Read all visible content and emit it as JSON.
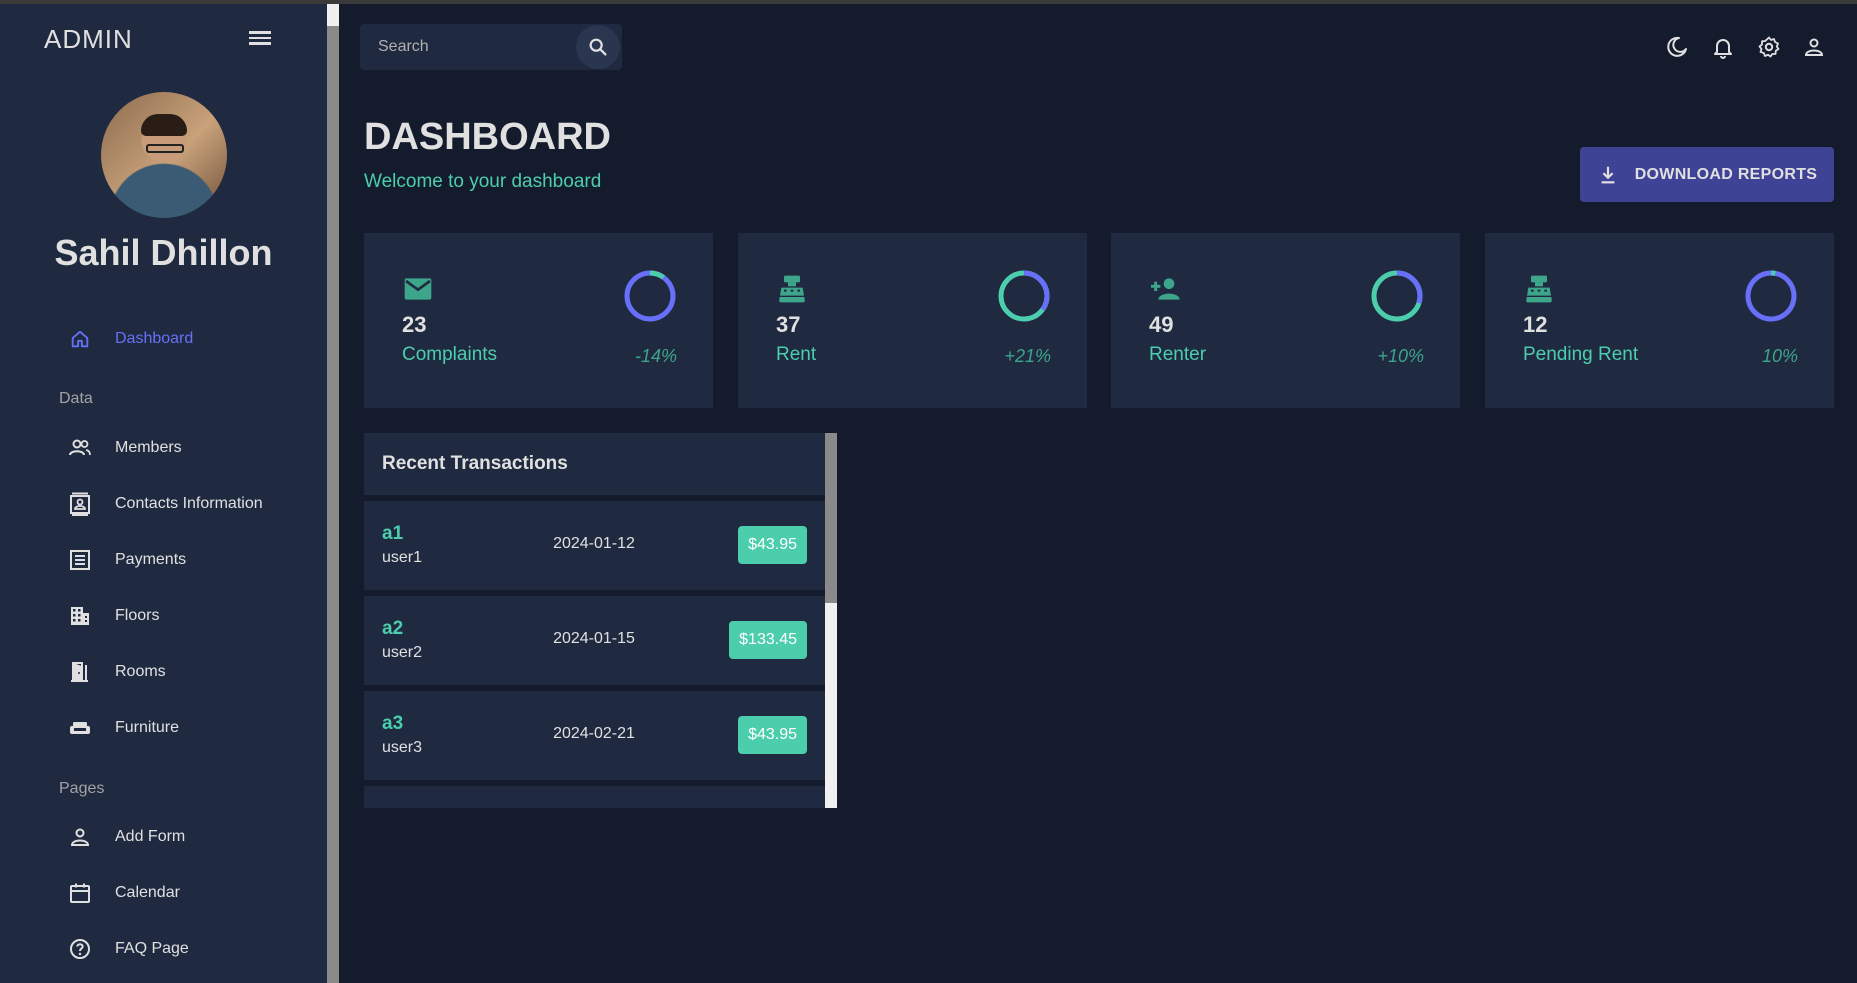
{
  "sidebar": {
    "brand": "ADMIN",
    "user_name": "Sahil Dhillon",
    "nav": [
      {
        "label": "Dashboard",
        "icon": "home-icon",
        "active": true
      },
      {
        "label": "Members",
        "icon": "people-icon"
      },
      {
        "label": "Contacts Information",
        "icon": "contacts-icon"
      },
      {
        "label": "Payments",
        "icon": "receipt-icon"
      },
      {
        "label": "Floors",
        "icon": "building-icon"
      },
      {
        "label": "Rooms",
        "icon": "door-icon"
      },
      {
        "label": "Furniture",
        "icon": "sofa-icon"
      },
      {
        "label": "Add Form",
        "icon": "person-icon"
      },
      {
        "label": "Calendar",
        "icon": "calendar-icon"
      },
      {
        "label": "FAQ Page",
        "icon": "help-icon"
      }
    ],
    "sections": {
      "data": "Data",
      "pages": "Pages"
    }
  },
  "topbar": {
    "search_placeholder": "Search",
    "icons": [
      "moon-icon",
      "bell-icon",
      "gear-icon",
      "person-icon"
    ]
  },
  "header": {
    "title": "DASHBOARD",
    "subtitle": "Welcome to your dashboard",
    "download_label": "DOWNLOAD REPORTS"
  },
  "stats": [
    {
      "value": "23",
      "label": "Complaints",
      "change": "-14%",
      "icon": "email-icon",
      "progress": 0.1
    },
    {
      "value": "37",
      "label": "Rent",
      "change": "+21%",
      "icon": "cash-register-icon",
      "progress": 0.35
    },
    {
      "value": "49",
      "label": "Renter",
      "change": "+10%",
      "icon": "person-add-icon",
      "progress": 0.3
    },
    {
      "value": "12",
      "label": "Pending Rent",
      "change": "10%",
      "icon": "cash-register-icon",
      "progress": 0.03
    }
  ],
  "transactions": {
    "title": "Recent Transactions",
    "rows": [
      {
        "id": "a1",
        "user": "user1",
        "date": "2024-01-12",
        "cost": "$43.95"
      },
      {
        "id": "a2",
        "user": "user2",
        "date": "2024-01-15",
        "cost": "$133.45"
      },
      {
        "id": "a3",
        "user": "user3",
        "date": "2024-02-21",
        "cost": "$43.95"
      }
    ]
  },
  "colors": {
    "background": "#141b2d",
    "panel": "#1f2a40",
    "accent_green": "#4cceac",
    "accent_blue": "#6870fa",
    "button": "#3e4396"
  }
}
